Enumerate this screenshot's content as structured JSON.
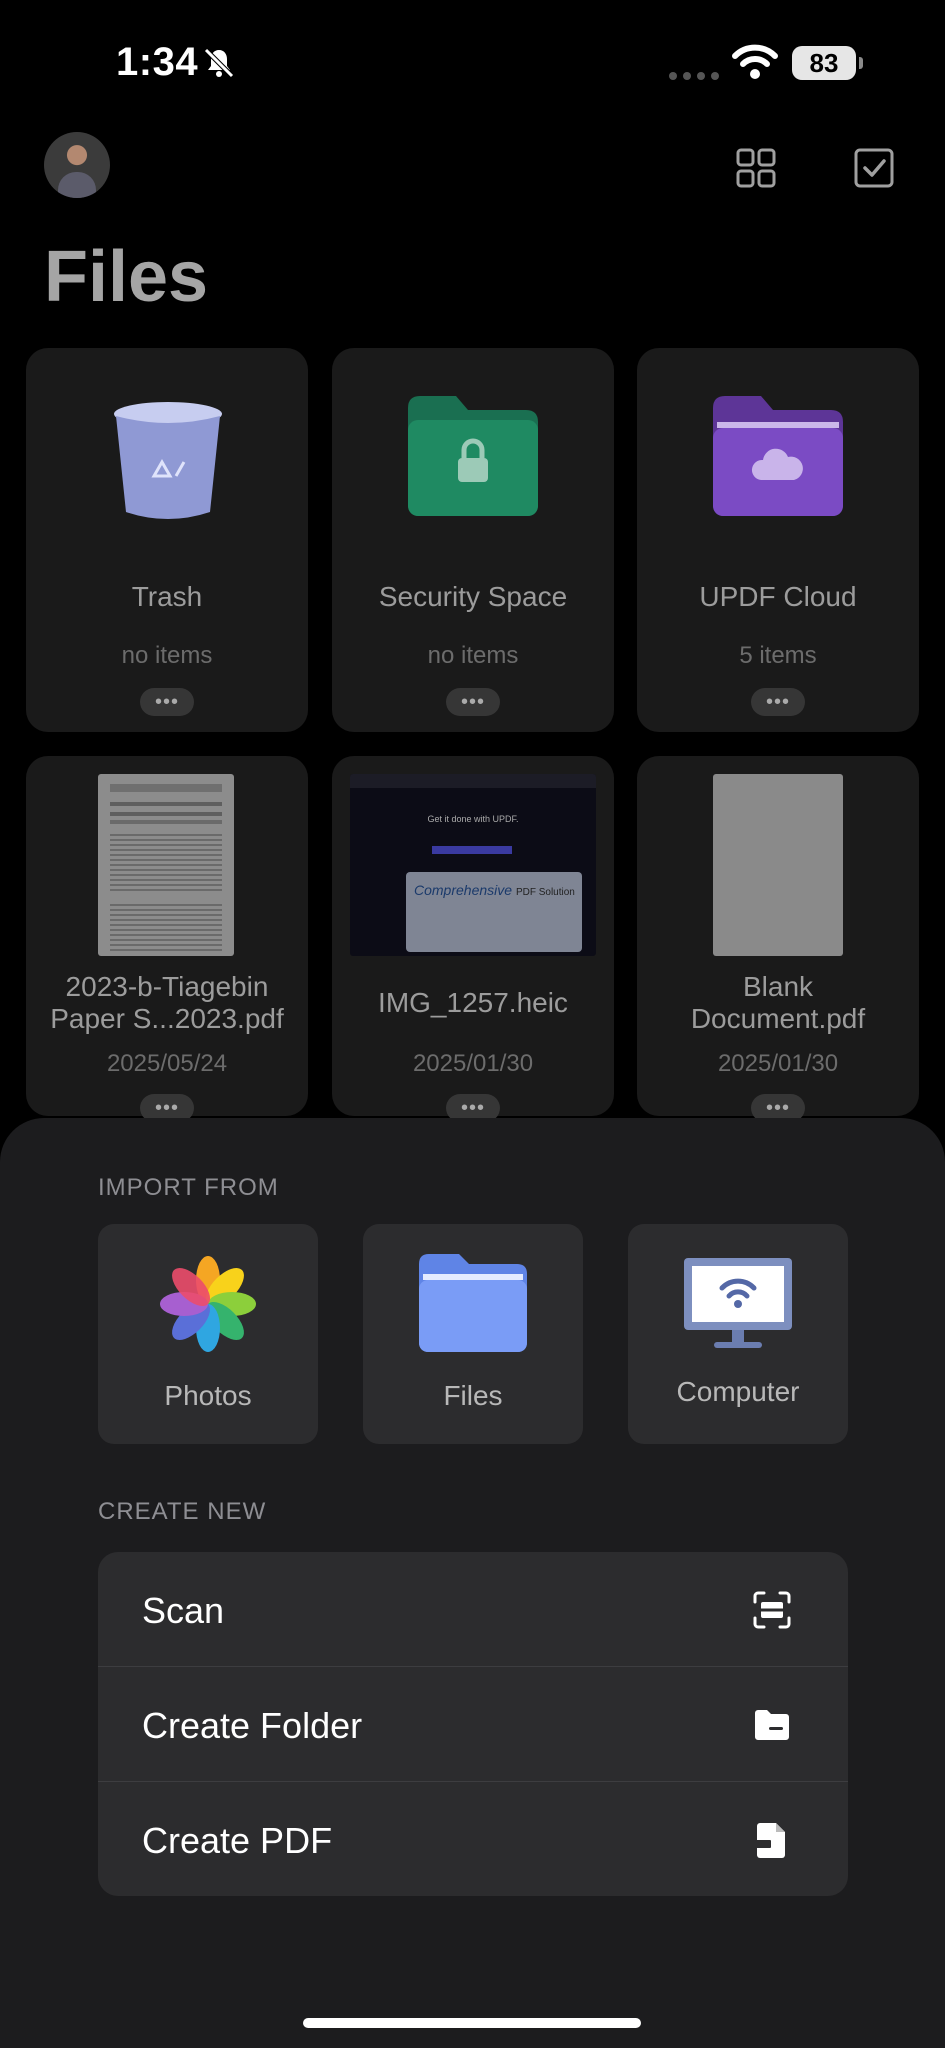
{
  "status_bar": {
    "time": "1:34",
    "battery": "83"
  },
  "header": {
    "title": "Files"
  },
  "folders": [
    {
      "name": "Trash",
      "meta": "no items",
      "icon": "trash-bin-icon"
    },
    {
      "name": "Security Space",
      "meta": "no items",
      "icon": "lock-folder-icon"
    },
    {
      "name": "UPDF Cloud",
      "meta": "5 items",
      "icon": "cloud-folder-icon"
    }
  ],
  "files": [
    {
      "name_line1": "2023-b-Tiagebin",
      "name_line2": "Paper S...2023.pdf",
      "date": "2025/05/24"
    },
    {
      "name_line1": "IMG_1257.heic",
      "name_line2": "",
      "date": "2025/01/30"
    },
    {
      "name_line1": "Blank",
      "name_line2": "Document.pdf",
      "date": "2025/01/30"
    }
  ],
  "thumb_text": {
    "img_headline": "Get it done with UPDF.",
    "img_banner_script": "Comprehensive",
    "img_banner_rest": "PDF Solution"
  },
  "sheet": {
    "import_label": "IMPORT FROM",
    "import_options": [
      "Photos",
      "Files",
      "Computer"
    ],
    "create_label": "CREATE NEW",
    "create_options": [
      "Scan",
      "Create Folder",
      "Create PDF"
    ]
  },
  "colors": {
    "background": "#000000",
    "sheet": "#1c1c1e",
    "card": "#2c2c2e",
    "security_folder": "#1f8a62",
    "cloud_folder": "#7b4bc4",
    "files_folder": "#6f95f5"
  }
}
